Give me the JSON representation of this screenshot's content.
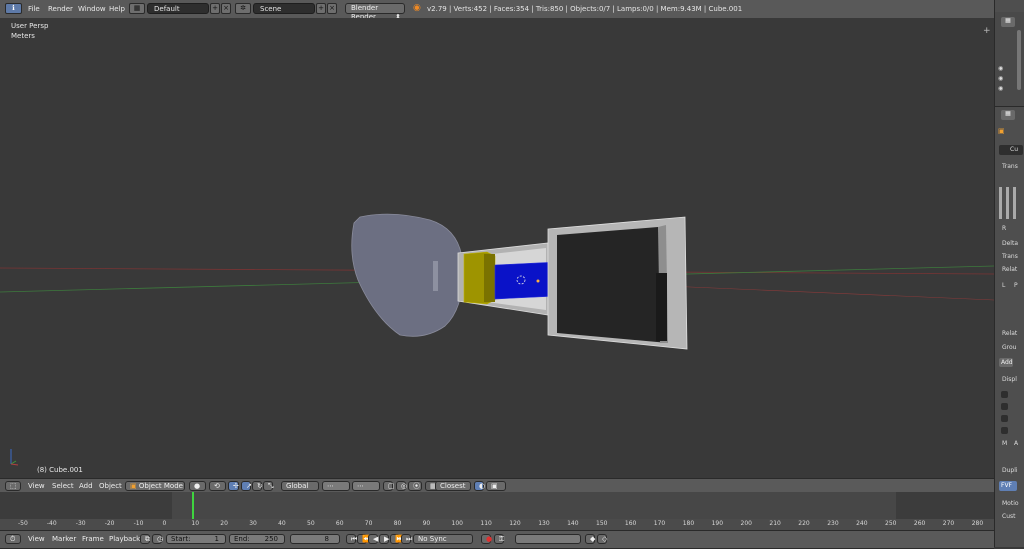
{
  "topbar": {
    "menus": [
      "File",
      "Render",
      "Window",
      "Help"
    ],
    "screen_layout": "Default",
    "scene": "Scene",
    "render_engine": "Blender Render",
    "stats": "v2.79 | Verts:452 | Faces:354 | Tris:850 | Objects:0/7 | Lamps:0/0 | Mem:9.43M | Cube.001"
  },
  "viewport": {
    "view_name": "User Persp",
    "units": "Meters",
    "selected_object": "(8) Cube.001"
  },
  "header3d": {
    "menus": [
      "View",
      "Select",
      "Add",
      "Object"
    ],
    "mode": "Object Mode",
    "orientation": "Global",
    "snap": "Closest"
  },
  "timeline": {
    "ticks": [
      "-50",
      "-40",
      "-30",
      "-20",
      "-10",
      "0",
      "10",
      "20",
      "30",
      "40",
      "50",
      "60",
      "70",
      "80",
      "90",
      "100",
      "110",
      "120",
      "130",
      "140",
      "150",
      "160",
      "170",
      "180",
      "190",
      "200",
      "210",
      "220",
      "230",
      "240",
      "250",
      "260",
      "270",
      "280"
    ]
  },
  "bottombar": {
    "menus": [
      "View",
      "Marker",
      "Frame",
      "Playback"
    ],
    "start_label": "Start:",
    "start_value": "1",
    "end_label": "End:",
    "end_value": "250",
    "current_frame": "8",
    "sync": "No Sync"
  },
  "properties": {
    "object_name": "Cu",
    "panels": [
      "Trans",
      "Delta",
      "Trans",
      "Relat",
      "Relat",
      "Grou",
      "Displ",
      "Dupli",
      "Motio",
      "Cust"
    ],
    "letters": [
      "R",
      "L",
      "P",
      "M",
      "A"
    ],
    "add_label": "Add",
    "dupli_value": "FVF"
  },
  "colors": {
    "background": "#393939",
    "header": "#595959",
    "shield": "#6c6f82",
    "gray_body": "#b4b4b4",
    "black_body": "#252525",
    "yellow": "#9e9400",
    "blue": "#0a12c8",
    "x_axis": "#8a3a3a",
    "y_axis": "#3a7a3a"
  }
}
